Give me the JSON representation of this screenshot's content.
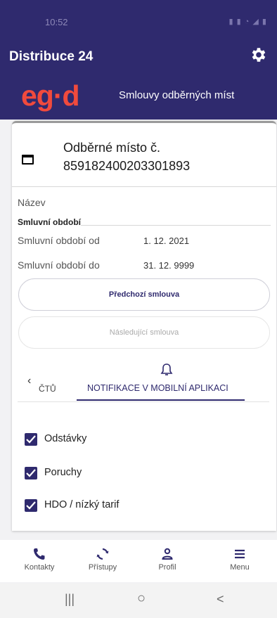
{
  "status_bar": {
    "time": "10:52"
  },
  "app_bar": {
    "title": "Distribuce 24"
  },
  "brand": {
    "logo_text": "eg·d",
    "subtitle": "Smlouvy odběrných míst"
  },
  "place": {
    "title_line1": "Odběrné místo č.",
    "title_line2": "859182400203301893"
  },
  "fields": {
    "name_label": "Název",
    "section_title": "Smluvní období",
    "from_label": "Smluvní období od",
    "from_value": "1. 12. 2021",
    "to_label": "Smluvní období do",
    "to_value": "31. 12. 9999"
  },
  "buttons": {
    "previous": "Předchozí smlouva",
    "next": "Následující smlouva"
  },
  "tabs": {
    "prev_fragment": "ČTŮ",
    "active_label": "NOTIFIKACE V MOBILNÍ APLIKACI"
  },
  "notifications": [
    {
      "label": "Odstávky",
      "checked": true
    },
    {
      "label": "Poruchy",
      "checked": true
    },
    {
      "label": "HDO / nízký tarif",
      "checked": true
    }
  ],
  "bottom_nav": {
    "contacts": "Kontakty",
    "access": "Přístupy",
    "profile": "Profil",
    "menu": "Menu"
  },
  "system_nav": {
    "recents": "|||",
    "home": "○",
    "back": "<"
  },
  "colors": {
    "primary": "#2f2a6e",
    "logo": "#f14a3d"
  }
}
